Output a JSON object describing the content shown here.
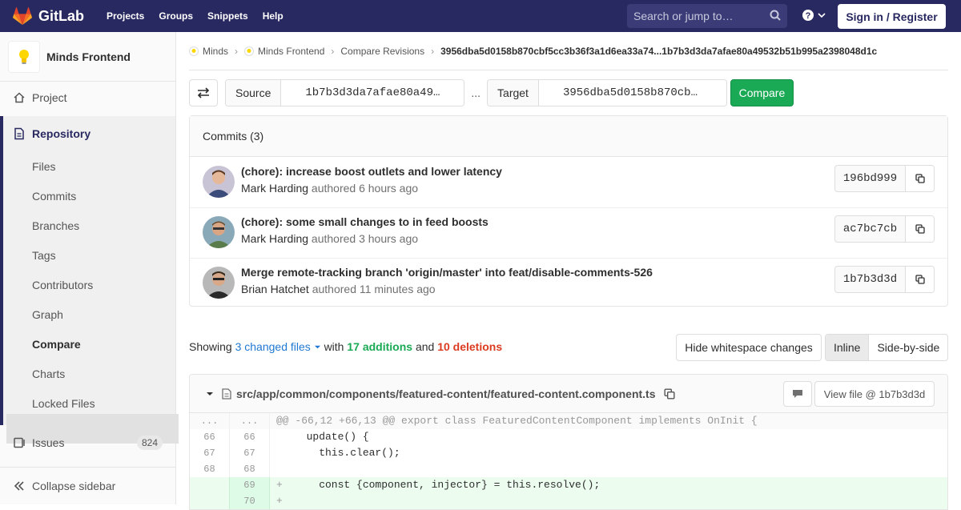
{
  "topnav": {
    "brand": "GitLab",
    "links": [
      "Projects",
      "Groups",
      "Snippets",
      "Help"
    ],
    "search_placeholder": "Search or jump to…",
    "signin": "Sign in / Register"
  },
  "sidebar": {
    "project_name": "Minds Frontend",
    "project": "Project",
    "repository": "Repository",
    "repo_items": [
      "Files",
      "Commits",
      "Branches",
      "Tags",
      "Contributors",
      "Graph",
      "Compare",
      "Charts",
      "Locked Files"
    ],
    "issues": "Issues",
    "issues_count": "824",
    "collapse": "Collapse sidebar"
  },
  "breadcrumb": {
    "items": [
      "Minds",
      "Minds Frontend",
      "Compare Revisions"
    ],
    "current": "3956dba5d0158b870cbf5cc3b36f3a1d6ea33a74...1b7b3d3da7afae80a49532b51b995a2398048d1c"
  },
  "compare": {
    "source_label": "Source",
    "source_value": "1b7b3d3da7afae80a49…",
    "dots": "...",
    "target_label": "Target",
    "target_value": "3956dba5d0158b870cb…",
    "button": "Compare"
  },
  "commits": {
    "header": "Commits (3)",
    "items": [
      {
        "title": "(chore): increase boost outlets and lower latency",
        "author": "Mark Harding",
        "authored": "authored",
        "ago": "6 hours ago",
        "sha": "196bd999"
      },
      {
        "title": "(chore): some small changes to in feed boosts",
        "author": "Mark Harding",
        "authored": "authored",
        "ago": "3 hours ago",
        "sha": "ac7bc7cb"
      },
      {
        "title": "Merge remote-tracking branch 'origin/master' into feat/disable-comments-526",
        "author": "Brian Hatchet",
        "authored": "authored",
        "ago": "11 minutes ago",
        "sha": "1b7b3d3d"
      }
    ]
  },
  "stats": {
    "showing": "Showing",
    "changed": "3 changed files",
    "with": "with",
    "additions": "17 additions",
    "and": "and",
    "deletions": "10 deletions"
  },
  "view": {
    "hide_ws": "Hide whitespace changes",
    "inline": "Inline",
    "side": "Side-by-side"
  },
  "file": {
    "path": "src/app/common/components/featured-content/featured-content.component.ts",
    "view_file": "View file @ 1b7b3d3d",
    "lines": [
      {
        "type": "hunk",
        "old": "...",
        "new": "...",
        "text": "@@ -66,12 +66,13 @@ export class FeaturedContentComponent implements OnInit {"
      },
      {
        "type": "ctx",
        "old": "66",
        "new": "66",
        "text": "  update() {"
      },
      {
        "type": "ctx",
        "old": "67",
        "new": "67",
        "text": "    this.clear();"
      },
      {
        "type": "ctx",
        "old": "68",
        "new": "68",
        "text": ""
      },
      {
        "type": "add",
        "old": "",
        "new": "69",
        "text": "    const {component, injector} = this.resolve();"
      },
      {
        "type": "add",
        "old": "",
        "new": "70",
        "text": ""
      }
    ]
  }
}
